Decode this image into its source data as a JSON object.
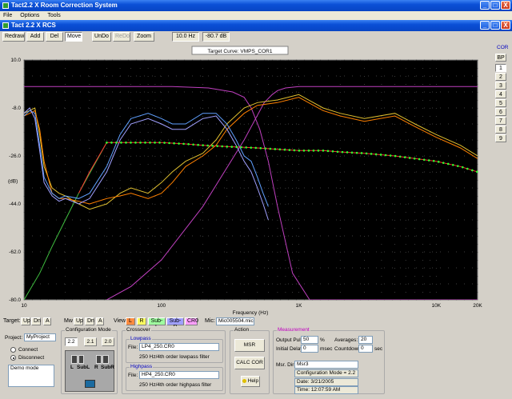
{
  "window": {
    "title": "Tact2.2 X Room Correction System",
    "child_title": "Tact 2.2 X RCS",
    "controls": [
      "_",
      "□",
      "X"
    ]
  },
  "menu": [
    "File",
    "Options",
    "Tools"
  ],
  "toolbar": {
    "redraw": "Redraw",
    "add": "Add",
    "del": "Del",
    "move": "Move",
    "undo": "UnDo",
    "redo": "ReDo",
    "zoom": "Zoom",
    "freq_readout": "10.0 Hz",
    "db_readout": "-80.7 dB"
  },
  "chart_data": {
    "type": "line",
    "title": "Target Curve: VMPS_COR1",
    "xlabel": "Frequency (Hz)",
    "ylabel": "(dB)",
    "x_scale": "log",
    "xlim": [
      10,
      20000
    ],
    "ylim": [
      -80,
      10
    ],
    "grid": true,
    "y_ticks": [
      10.0,
      -8.0,
      -26.0,
      -44.0,
      -62.0,
      -80.0
    ],
    "y_tick_labels": [
      "10.0",
      "-8.0",
      "-26.0",
      "-44.0",
      "-62.0",
      "-80.0"
    ],
    "x_ticks": [
      10,
      100,
      1000,
      10000,
      20000
    ],
    "x_tick_labels": [
      "10",
      "100",
      "1K",
      "10K",
      "20K"
    ],
    "series": [
      {
        "color": "#c040c0",
        "x": [
          10,
          40,
          120,
          220,
          330,
          400,
          450,
          520,
          600,
          700,
          900,
          1200,
          2000,
          5000,
          10000,
          20000
        ],
        "y": [
          0,
          0,
          0,
          -0.5,
          -2,
          -4,
          -8,
          -16,
          -28,
          -45,
          -70,
          -80,
          -80,
          -80,
          -80,
          -80
        ]
      },
      {
        "color": "#c040c0",
        "x": [
          40,
          60,
          100,
          200,
          400,
          560,
          640,
          700,
          800,
          1000,
          2000,
          5000,
          10000,
          20000
        ],
        "y": [
          -80,
          -75,
          -65,
          -45,
          -20,
          -6,
          -3,
          -1.5,
          -0.5,
          0,
          0,
          0,
          0,
          0
        ]
      },
      {
        "color": "#40c040",
        "x": [
          10,
          13,
          16,
          20,
          25,
          32,
          40
        ],
        "y": [
          -80,
          -70,
          -60,
          -50,
          -40,
          -30,
          -21
        ]
      },
      {
        "color": "#e0c030",
        "x": [
          10,
          11,
          12,
          13,
          14,
          16,
          18,
          20,
          25,
          30,
          40,
          50,
          60,
          80,
          100,
          120,
          150,
          200,
          250,
          300,
          400,
          500,
          700,
          1000,
          1500,
          2000,
          3000,
          5000,
          7000,
          10000,
          15000,
          20000
        ],
        "y": [
          -10,
          -9,
          -8,
          -18,
          -30,
          -38,
          -40,
          -41,
          -44,
          -46,
          -44,
          -40,
          -38,
          -40,
          -36,
          -32,
          -28,
          -25,
          -20,
          -14,
          -8,
          -6,
          -5,
          -3,
          -8,
          -10,
          -12,
          -10,
          -14,
          -18,
          -22,
          -26
        ]
      },
      {
        "color": "#ff8000",
        "x": [
          10,
          11,
          12,
          13,
          14,
          16,
          18,
          20,
          25,
          30,
          40,
          50,
          60,
          80,
          100,
          120,
          150,
          200,
          250,
          300,
          400,
          500,
          700,
          1000,
          1500,
          2000,
          3000,
          5000,
          7000,
          10000,
          15000,
          20000
        ],
        "y": [
          -11,
          -10,
          -9,
          -16,
          -28,
          -40,
          -42,
          -42,
          -43,
          -44,
          -42,
          -41,
          -40,
          -42,
          -40,
          -36,
          -30,
          -26,
          -22,
          -16,
          -10,
          -7,
          -6,
          -4,
          -9,
          -11,
          -13,
          -11,
          -15,
          -19,
          -23,
          -27
        ]
      },
      {
        "color": "#60a0ff",
        "x": [
          10,
          11,
          12,
          13,
          14,
          16,
          18,
          20,
          25,
          30,
          40,
          50,
          60,
          80,
          100,
          120,
          150,
          200,
          250,
          300,
          350,
          400,
          450,
          500,
          550,
          600
        ],
        "y": [
          -11,
          -9,
          -10,
          -22,
          -34,
          -40,
          -42,
          -41,
          -42,
          -40,
          -30,
          -18,
          -12,
          -10,
          -12,
          -14,
          -14,
          -10,
          -10,
          -14,
          -20,
          -26,
          -28,
          -34,
          -40,
          -45
        ]
      },
      {
        "color": "#a0a0ff",
        "x": [
          10,
          11,
          12,
          13,
          14,
          16,
          18,
          20,
          25,
          30,
          40,
          50,
          60,
          80,
          100,
          120,
          150,
          200,
          250,
          300,
          350,
          400,
          450,
          500,
          550,
          600
        ],
        "y": [
          -10,
          -8,
          -12,
          -24,
          -36,
          -41,
          -43,
          -42,
          -44,
          -42,
          -32,
          -20,
          -14,
          -12,
          -14,
          -16,
          -16,
          -12,
          -11,
          -16,
          -22,
          -28,
          -32,
          -38,
          -44,
          -50
        ]
      },
      {
        "color": "#ff3030",
        "x": [
          25,
          30,
          40,
          50,
          70,
          100,
          150,
          200,
          300,
          500,
          700,
          1000,
          1500,
          2000,
          3000,
          5000,
          7000,
          10000,
          15000,
          20000
        ],
        "y": [
          -40,
          -32,
          -21,
          -21,
          -21,
          -21,
          -21.5,
          -22,
          -22.5,
          -23,
          -23.5,
          -24,
          -24,
          -24.5,
          -25,
          -26,
          -27,
          -28,
          -30,
          -32
        ]
      }
    ]
  },
  "cor_panel": {
    "label": "COR",
    "buttons": [
      "BP",
      "1",
      "2",
      "3",
      "4",
      "5",
      "6",
      "7",
      "8",
      "9"
    ]
  },
  "chart_controls": {
    "target_label": "Target:",
    "target_buttons": [
      "Up",
      "Dn",
      "A"
    ],
    "mw_label": "Mw",
    "mw_buttons": [
      "Up",
      "Dn",
      "A"
    ],
    "view_label": "View",
    "view_buttons": [
      {
        "label": "L",
        "color": "#ff8c40"
      },
      {
        "label": "R",
        "color": "#ffff60"
      },
      {
        "label": "Sub-L",
        "color": "#a0ffa0"
      },
      {
        "label": "Sub-R",
        "color": "#a0a0ff"
      },
      {
        "label": "CR0",
        "color": "#ffa0ff"
      }
    ],
    "mic_label": "Mic:",
    "mic_value": "Mic005504.mic"
  },
  "project": {
    "label": "Project:",
    "value": "MyProject",
    "connect": "Connect",
    "disconnect": "Disconnect",
    "mode_text": "Demo mode"
  },
  "config_mode": {
    "title": "Configuration Mode",
    "buttons": [
      "2.2",
      "2.1",
      "2.0"
    ],
    "speaker_l": "L",
    "speaker_subl": "SubL",
    "speaker_r": "R",
    "speaker_subr": "SubR"
  },
  "crossover": {
    "title": "Crossover",
    "lowpass": {
      "title": "Lowpass",
      "file_label": "File:",
      "file": "LP4_250.CR0",
      "desc": "250 Hz/4th order lowpass filter"
    },
    "highpass": {
      "title": "Highpass",
      "file_label": "File:",
      "file": "HP4_250.CR0",
      "desc": "250 Hz/4th order highpass filter"
    }
  },
  "action": {
    "title": "Action",
    "msr": "MSR",
    "calc": "CALC COR",
    "help": "Help"
  },
  "measurement": {
    "title": "Measurement",
    "output_pulse_label": "Output Pulse:",
    "output_pulse": "50",
    "output_pulse_unit": "%",
    "initial_delay_label": "Initial Delay:",
    "initial_delay": "0",
    "initial_delay_unit": "msec",
    "averages_label": "Averages:",
    "averages": "20",
    "countdown_label": "Countdown:",
    "countdown": "0",
    "countdown_unit": "sec",
    "msr_dir_label": "Msr. Dir:",
    "msr_dir": "Msr3",
    "config_text": "Configuration Mode = 2.2",
    "date": "Date: 3/21/2005",
    "time": "Time: 12:07:59 AM"
  }
}
